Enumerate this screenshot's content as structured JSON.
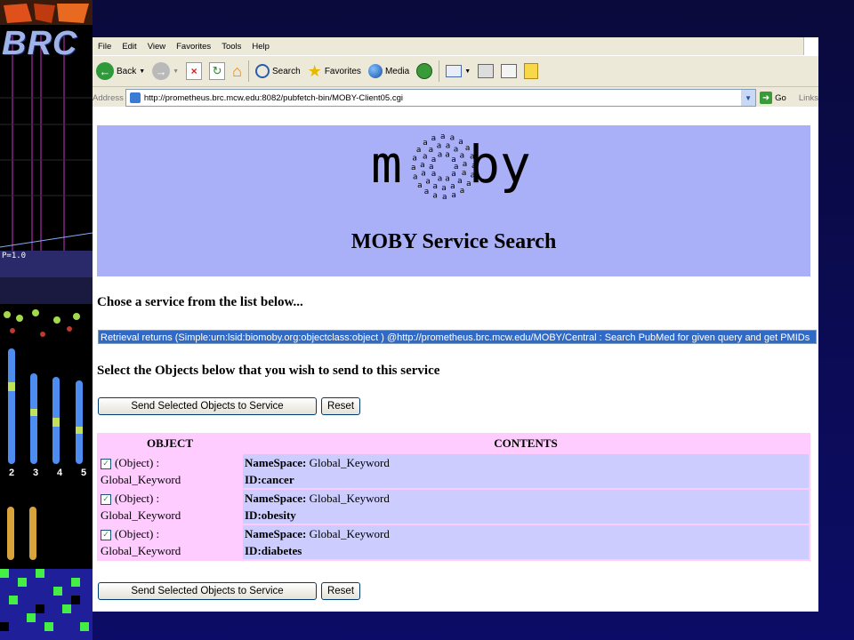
{
  "side": {
    "logo_text": "BRC",
    "chromosome_numbers": [
      "2",
      "3",
      "4",
      "5"
    ],
    "grid_label": "P=1.0"
  },
  "browser": {
    "menu": [
      "File",
      "Edit",
      "View",
      "Favorites",
      "Tools",
      "Help"
    ],
    "toolbar": {
      "back_label": "Back",
      "search_label": "Search",
      "favorites_label": "Favorites",
      "media_label": "Media"
    },
    "address": {
      "label": "Address",
      "url": "http://prometheus.brc.mcw.edu:8082/pubfetch-bin/MOBY-Client05.cgi",
      "go_label": "Go",
      "links_label": "Links"
    }
  },
  "page": {
    "logo_text": "moby",
    "title": "MOBY Service Search",
    "chose_prompt": "Chose a service from the list below...",
    "service_option": "Retrieval returns (Simple:urn:lsid:biomoby.org:objectclass:object ) @http://prometheus.brc.mcw.edu/MOBY/Central : Search PubMed for given query and get PMIDs",
    "select_prompt": "Select the Objects below that you wish to send to this service",
    "send_button": "Send Selected Objects to Service",
    "reset_button": "Reset",
    "table": {
      "headers": [
        "OBJECT",
        "CONTENTS"
      ],
      "rows": [
        {
          "object_line1": "(Object) :",
          "object_line2": "Global_Keyword",
          "ns_label": "NameSpace:",
          "ns_value": "Global_Keyword",
          "id": "ID:cancer",
          "checked": true
        },
        {
          "object_line1": "(Object) :",
          "object_line2": "Global_Keyword",
          "ns_label": "NameSpace:",
          "ns_value": "Global_Keyword",
          "id": "ID:obesity",
          "checked": true
        },
        {
          "object_line1": "(Object) :",
          "object_line2": "Global_Keyword",
          "ns_label": "NameSpace:",
          "ns_value": "Global_Keyword",
          "id": "ID:diabetes",
          "checked": true
        }
      ]
    }
  },
  "colors": {
    "banner": "#aab0f7",
    "object_cell": "#ffccff",
    "contents_cell": "#ccccff",
    "selected": "#316ac5"
  }
}
